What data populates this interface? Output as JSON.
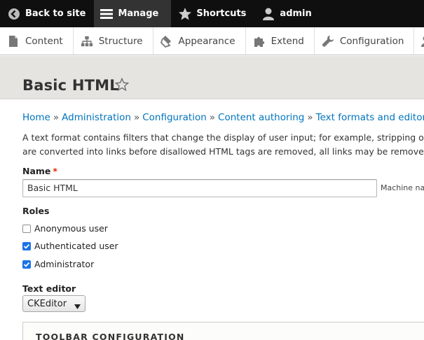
{
  "toolbar": {
    "back_label": "Back to site",
    "manage_label": "Manage",
    "shortcuts_label": "Shortcuts",
    "user_label": "admin"
  },
  "tray": {
    "items": [
      {
        "label": "Content",
        "icon": "page-icon"
      },
      {
        "label": "Structure",
        "icon": "hierarchy-icon"
      },
      {
        "label": "Appearance",
        "icon": "paint-icon"
      },
      {
        "label": "Extend",
        "icon": "puzzle-icon"
      },
      {
        "label": "Configuration",
        "icon": "wrench-icon"
      }
    ]
  },
  "page": {
    "title": "Basic HTML"
  },
  "breadcrumb": [
    "Home",
    "Administration",
    "Configuration",
    "Content authoring",
    "Text formats and editors"
  ],
  "breadcrumb_sep": "»",
  "description": {
    "line1": "A text format contains filters that change the display of user input; for example, stripping o",
    "line2": "are converted into links before disallowed HTML tags are removed, all links may be remove"
  },
  "form": {
    "name_label": "Name",
    "required_mark": "*",
    "name_value": "Basic HTML",
    "machine_name_label": "Machine nar",
    "roles_label": "Roles",
    "roles": [
      {
        "label": "Anonymous user",
        "checked": false
      },
      {
        "label": "Authenticated user",
        "checked": true
      },
      {
        "label": "Administrator",
        "checked": true
      }
    ],
    "editor_label": "Text editor",
    "editor_value": "CKEditor",
    "toolbar_config_label": "TOOLBAR CONFIGURATION"
  },
  "colors": {
    "toolbar_bg": "#0f0f0f",
    "link": "#0074bd",
    "required": "#e32700",
    "checkbox_checked": "#1a73e8",
    "header_band": "#e5e4e0"
  }
}
